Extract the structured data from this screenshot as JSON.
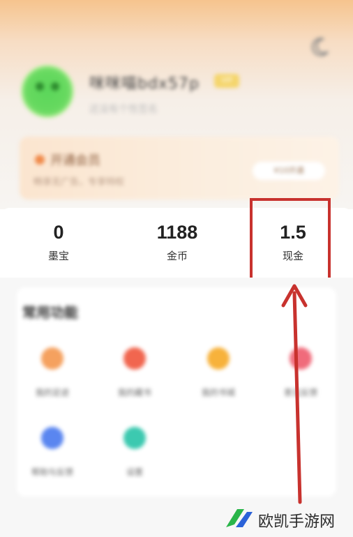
{
  "profile": {
    "username": "咪咪喵bdx57p",
    "vip_badge": "VIP",
    "subtitle": "还没有个性签名"
  },
  "vip_card": {
    "title": "开通会员",
    "desc": "畅享无广告，专享特权",
    "button": "¥10开通"
  },
  "stats": [
    {
      "value": "0",
      "label": "墨宝"
    },
    {
      "value": "1188",
      "label": "金币"
    },
    {
      "value": "1.5",
      "label": "现金"
    }
  ],
  "common": {
    "title": "常用功能",
    "items": [
      {
        "label": "我的足迹",
        "icon": "footprint-icon",
        "color": "#f5a15f"
      },
      {
        "label": "我的藏书",
        "icon": "heart-icon",
        "color": "#f1664f"
      },
      {
        "label": "我的书城",
        "icon": "store-icon",
        "color": "#f7b23b"
      },
      {
        "label": "意见反馈",
        "icon": "feedback-icon",
        "color": "#f06b7b"
      },
      {
        "label": "帮助与反馈",
        "icon": "help-icon",
        "color": "#5a86f0"
      },
      {
        "label": "设置",
        "icon": "settings-icon",
        "color": "#3cc9b0"
      }
    ]
  },
  "colors": {
    "highlight": "#c8322e",
    "accent_orange": "#f6c48e"
  },
  "watermark": {
    "text": "欧凯手游网"
  }
}
